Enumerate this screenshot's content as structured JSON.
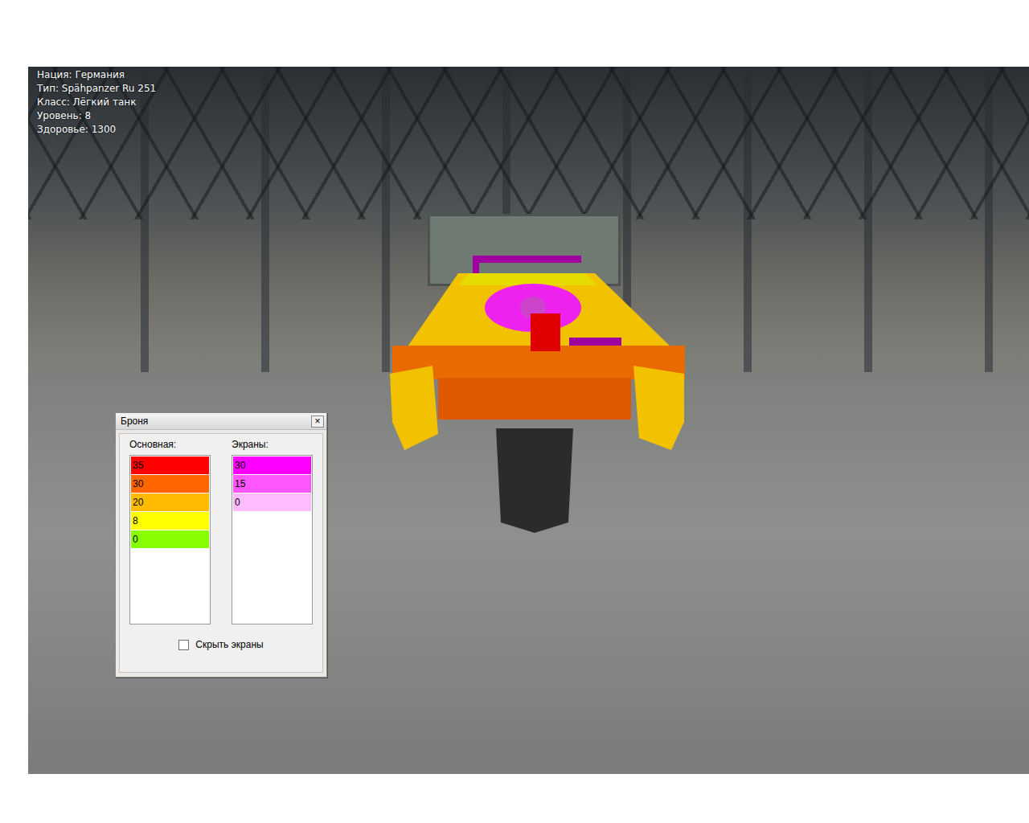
{
  "info": [
    "Нация: Германия",
    "Тип: Spähpanzer Ru 251",
    "Класс: Лёгкий танк",
    "Уровень: 8",
    "Здоровье: 1300"
  ],
  "panel": {
    "title": "Броня",
    "close": "×",
    "main": {
      "label": "Основная:",
      "rows": [
        {
          "value": "35",
          "color": "#ff0000"
        },
        {
          "value": "30",
          "color": "#ff6600"
        },
        {
          "value": "20",
          "color": "#ffbb00"
        },
        {
          "value": "8",
          "color": "#ffff00"
        },
        {
          "value": "0",
          "color": "#88ff00"
        }
      ]
    },
    "screens": {
      "label": "Экраны:",
      "rows": [
        {
          "value": "30",
          "color": "#ff00ff"
        },
        {
          "value": "15",
          "color": "#ff55ff"
        },
        {
          "value": "0",
          "color": "#ffbbff"
        }
      ]
    },
    "hide_screens": {
      "label": "Скрыть экраны",
      "checked": false
    }
  }
}
